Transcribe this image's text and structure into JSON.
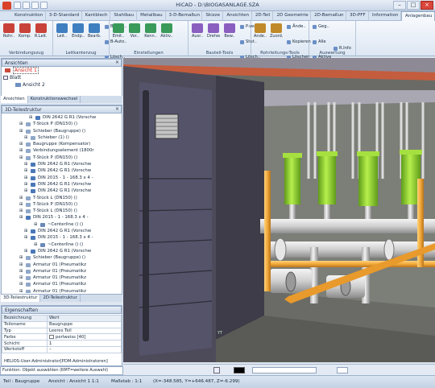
{
  "window": {
    "title": "HiCAD - D:\\BIOGASANLAGE.SZA",
    "minimize": "–",
    "maximize": "□",
    "close": "×"
  },
  "tabs": [
    "Konstruktion",
    "3-D-Standard",
    "Kantblech",
    "Stahlbau",
    "Metallbau",
    "3-D-Bemaßun",
    "Skizze",
    "Ansichten",
    "2D-Teil",
    "2D Geometrie",
    "2D-Bemaßun",
    "3D-PFF",
    "Information",
    "Anlagenbau"
  ],
  "active_tab": "Anlagenbau",
  "ribbon": {
    "groups": [
      {
        "label": "Verbindungszug",
        "buttons": [
          "Rohr..",
          "Komp..",
          "R.Leit.."
        ],
        "color": "#c9423a"
      },
      {
        "label": "Leitkantenzug",
        "buttons": [
          "Leit..",
          "Endp..",
          "Bearb.."
        ],
        "color": "#3f7fc0"
      },
      {
        "label": "Einstellungen",
        "buttons": [
          "Emit..",
          "Vor..",
          "Kenn..",
          "Aktiv.."
        ],
        "color": "#3a9a5a"
      },
      {
        "label": "Bauteil-Tools",
        "buttons": [
          "Ausr..",
          "Drehen",
          "Bew.."
        ],
        "color": "#8a5fc0"
      },
      {
        "label": "Rohrleitungs-Tools",
        "buttons": [
          "Ände..",
          "Zuord.."
        ],
        "color": "#c08a2a"
      },
      {
        "label": "Auswertung",
        "buttons": [],
        "color": "#3f7fc0"
      }
    ],
    "small_items": [
      "B-Auto..",
      "B-Auto..",
      "Lösch..",
      "P.ver..",
      "Stut..",
      "Lösch..",
      "Ände..",
      "Kopieren",
      "Löschen",
      "Geg..",
      "Alle",
      "Aktive",
      "R.Info",
      "R.Info",
      "B.Info"
    ]
  },
  "views_panel": {
    "title": "Ansichten",
    "items": [
      "Ansicht 1",
      "Blatt",
      "Ansicht 2"
    ]
  },
  "views_tabs": [
    "Ansichten",
    "Konstruktionswechsel"
  ],
  "tree_panel": {
    "title": "3D-Teilestruktur",
    "rows": [
      {
        "indent": 7,
        "text": "DIN 2642 G R1 (Vorschw",
        "color": "#4a78b8"
      },
      {
        "indent": 5,
        "text": "T-Stück P (DN150) ()",
        "color": "#8fa7c8"
      },
      {
        "indent": 5,
        "text": "Schieber (Baugruppe) ()",
        "color": "#8fa7c8"
      },
      {
        "indent": 6,
        "text": "Schieber (1) ()",
        "color": "#8fa7c8"
      },
      {
        "indent": 5,
        "text": "Baugruppe (Kompensator)",
        "color": "#8fa7c8"
      },
      {
        "indent": 5,
        "text": "Verbindungselement (1800r",
        "color": "#8fa7c8"
      },
      {
        "indent": 5,
        "text": "T-Stück P (DN150) ()",
        "color": "#8fa7c8"
      },
      {
        "indent": 6,
        "text": "DIN 2642 G R1 (Vorschw",
        "color": "#4a78b8"
      },
      {
        "indent": 6,
        "text": "DIN 2642 G R1 (Vorschw",
        "color": "#4a78b8"
      },
      {
        "indent": 6,
        "text": "DIN 2015 - 1 - 168.3 x 4 -",
        "color": "#4a78b8"
      },
      {
        "indent": 6,
        "text": "DIN 2642 G R1 (Vorschw",
        "color": "#4a78b8"
      },
      {
        "indent": 6,
        "text": "DIN 2642 G R1 (Vorschw",
        "color": "#4a78b8"
      },
      {
        "indent": 5,
        "text": "T-Stück L (DN150) ()",
        "color": "#8fa7c8"
      },
      {
        "indent": 5,
        "text": "T-Stück P (DN150) ()",
        "color": "#8fa7c8"
      },
      {
        "indent": 5,
        "text": "T-Stück L (DN150) ()",
        "color": "#8fa7c8"
      },
      {
        "indent": 5,
        "text": "DIN 2015 - 1 - 168.3 x 4 -",
        "color": "#4a78b8"
      },
      {
        "indent": 8,
        "text": "~Centerline () ()",
        "color": "#6a8ab8"
      },
      {
        "indent": 6,
        "text": "DIN 2642 G R1 (Vorschw",
        "color": "#4a78b8"
      },
      {
        "indent": 6,
        "text": "DIN 2015 - 1 - 168.3 x 4 -",
        "color": "#4a78b8"
      },
      {
        "indent": 8,
        "text": "~Centerline () ()",
        "color": "#6a8ab8"
      },
      {
        "indent": 6,
        "text": "DIN 2642 G R1 (Vorschw",
        "color": "#4a78b8"
      },
      {
        "indent": 5,
        "text": "Schieber (Baugruppe) ()",
        "color": "#8fa7c8"
      },
      {
        "indent": 5,
        "text": "Armatur 01 (Pneumatikz",
        "color": "#8fa7c8"
      },
      {
        "indent": 5,
        "text": "Armatur 01 (Pneumatikz",
        "color": "#8fa7c8"
      },
      {
        "indent": 5,
        "text": "Armatur 01 (Pneumatikz",
        "color": "#8fa7c8"
      },
      {
        "indent": 5,
        "text": "Armatur 01 (Pneumatikz",
        "color": "#8fa7c8"
      },
      {
        "indent": 5,
        "text": "Armatur 01 (Pneumatikz",
        "color": "#8fa7c8"
      }
    ]
  },
  "tree_tabs": [
    "3D-Teilestruktur",
    "2D-Teilestruktur"
  ],
  "properties": {
    "title": "Eigenschaften",
    "header": [
      "Bezeichnung",
      "Wert"
    ],
    "rows": [
      [
        "Teilename",
        "Baugruppe"
      ],
      [
        "Typ",
        "Leeres Teil"
      ],
      [
        "Farbe",
        "perlweiss [40]"
      ],
      [
        "Schicht",
        "1"
      ],
      [
        "Werkstoff",
        "–"
      ]
    ],
    "footer": "HELIOS-User:Administrator[PDM-Administratoren]"
  },
  "command_line": {
    "text": "Funktion: Objekt auswählen (RMT=weitere Auswahl)"
  },
  "status": {
    "part": "Teil : Baugruppe",
    "view": "Ansicht : Ansicht 1 1:1",
    "scale": "Maßstab : 1:1",
    "coords": "(X=-348.585, Y=+646.487, Z=-6.299)"
  },
  "colors": {
    "pipe": "#f2a93a",
    "valve": "#8bd12a",
    "wall": "#4e4c5c",
    "gray_pipe": "#c9c9c9"
  }
}
